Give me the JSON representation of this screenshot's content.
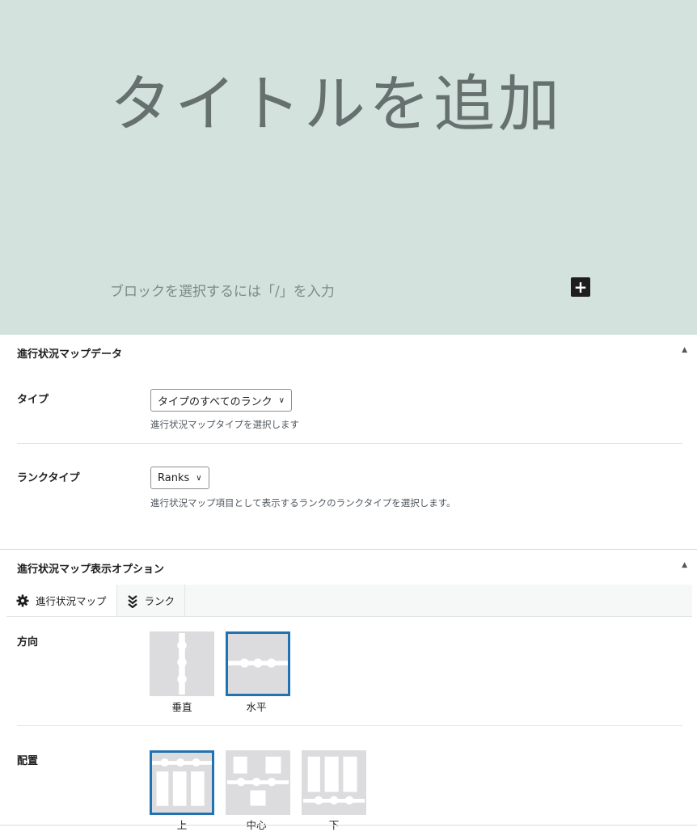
{
  "editor": {
    "title_placeholder": "タイトルを追加",
    "block_placeholder": "ブロックを選択するには「/」を入力",
    "inserter_symbol": "+"
  },
  "map_data_panel": {
    "title": "進行状況マップデータ",
    "type_field": {
      "label": "タイプ",
      "selected": "タイプのすべてのランク",
      "help": "進行状況マップタイプを選択します"
    },
    "rank_type_field": {
      "label": "ランクタイプ",
      "selected": "Ranks",
      "help": "進行状況マップ項目として表示するランクのランクタイプを選択します。"
    }
  },
  "display_options_panel": {
    "title": "進行状況マップ表示オプション",
    "tabs": [
      {
        "label": "進行状況マップ",
        "icon": "gear-icon",
        "active": true
      },
      {
        "label": "ランク",
        "icon": "rank-chevrons-icon",
        "active": false
      }
    ],
    "orientation": {
      "label": "方向",
      "options": [
        {
          "label": "垂直",
          "selected": false
        },
        {
          "label": "水平",
          "selected": true
        }
      ]
    },
    "alignment": {
      "label": "配置",
      "options": [
        {
          "label": "上",
          "selected": true
        },
        {
          "label": "中心",
          "selected": false
        },
        {
          "label": "下",
          "selected": false
        }
      ]
    }
  },
  "colors": {
    "editor_background": "#d3e2dc",
    "selected_border": "#2271b1",
    "option_background": "#dcdcde"
  }
}
